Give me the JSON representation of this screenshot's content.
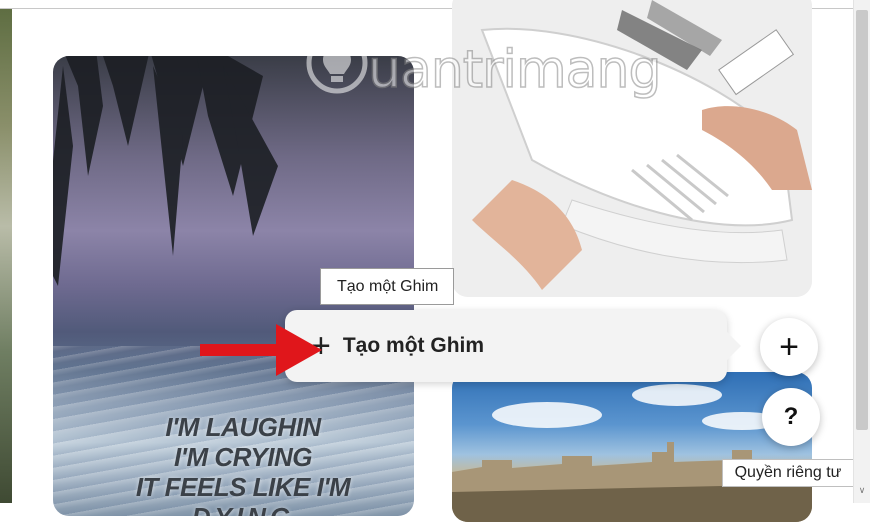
{
  "watermark": {
    "text": "uantrimang"
  },
  "pins": {
    "quote": {
      "lines": [
        "I'M LAUGHIN",
        "I'M CRYING",
        "IT FEELS LIKE I'M",
        "DYING"
      ]
    }
  },
  "tooltip_small": {
    "text": "Tạo một Ghim"
  },
  "create_pin_menu": {
    "icon": "+",
    "label": "Tạo một Ghim"
  },
  "buttons": {
    "plus": "+",
    "help": "?"
  },
  "privacy_tooltip": {
    "text": "Quyền riêng tư"
  },
  "colors": {
    "arrow": "#e0161b",
    "menu_bg": "#f3f3f3"
  },
  "icons": {
    "create": "plus-icon",
    "help": "question-icon",
    "watermark": "lightbulb-icon"
  }
}
